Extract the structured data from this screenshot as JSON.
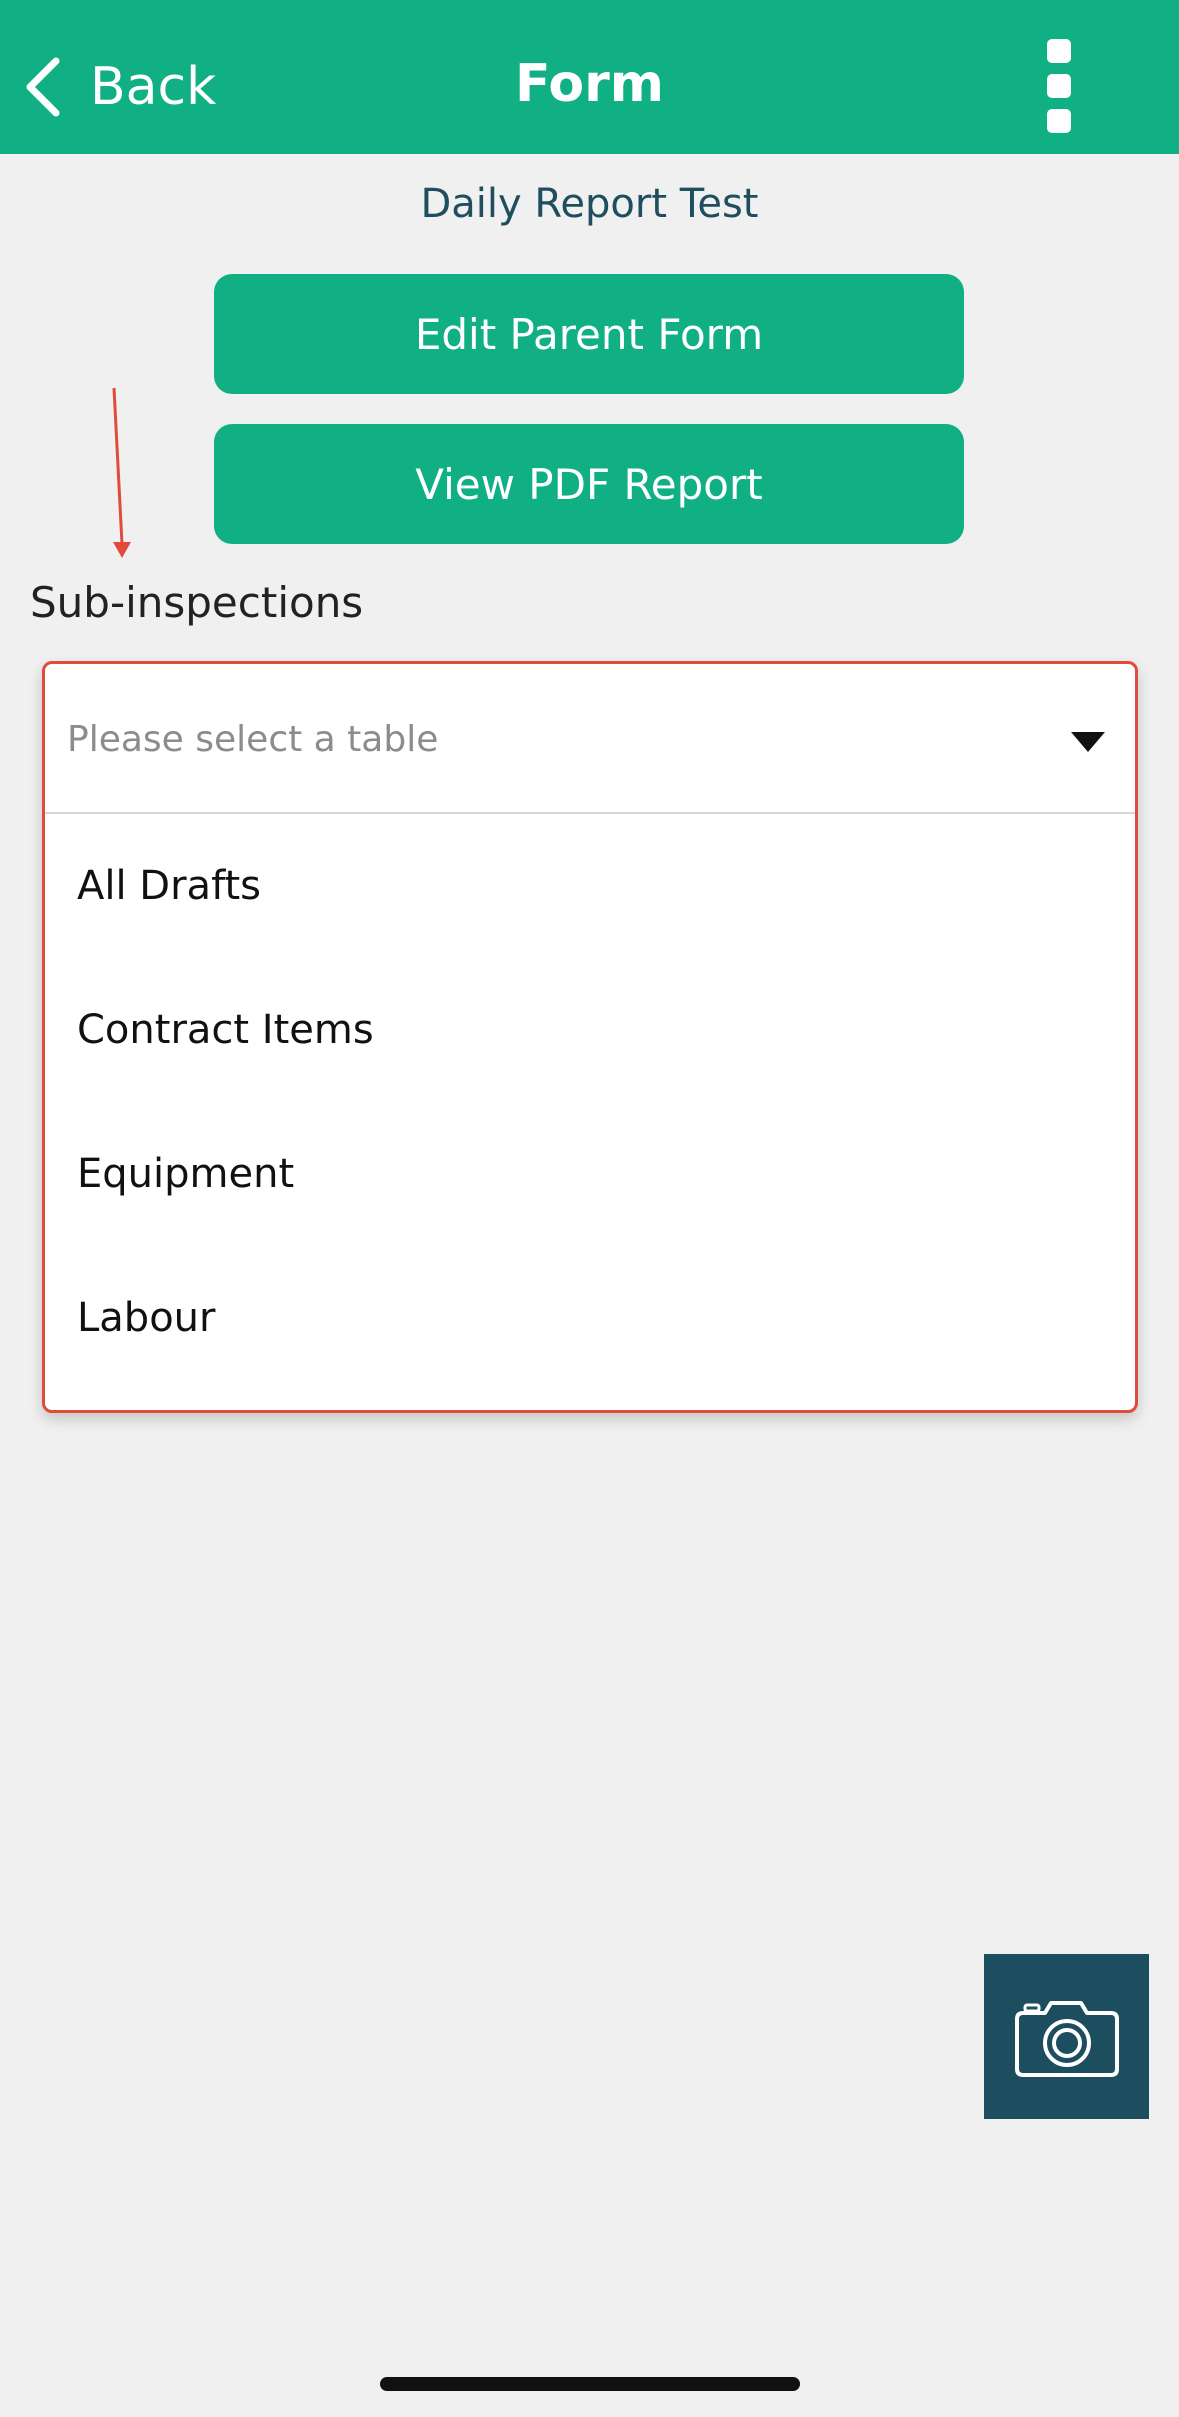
{
  "header": {
    "back_label": "Back",
    "title": "Form",
    "background_color": "#11b084"
  },
  "form": {
    "name": "Daily Report Test",
    "edit_parent_label": "Edit Parent Form",
    "view_pdf_label": "View PDF Report",
    "button_color": "#11b084"
  },
  "sub_inspections": {
    "label": "Sub-inspections",
    "select": {
      "placeholder": "Please select a table",
      "expanded": true,
      "options": [
        "All Drafts",
        "Contract Items",
        "Equipment",
        "Labour"
      ]
    }
  },
  "annotation": {
    "color": "#e04c3c"
  },
  "camera": {
    "icon": "camera-icon",
    "background_color": "#1d4e5f"
  }
}
